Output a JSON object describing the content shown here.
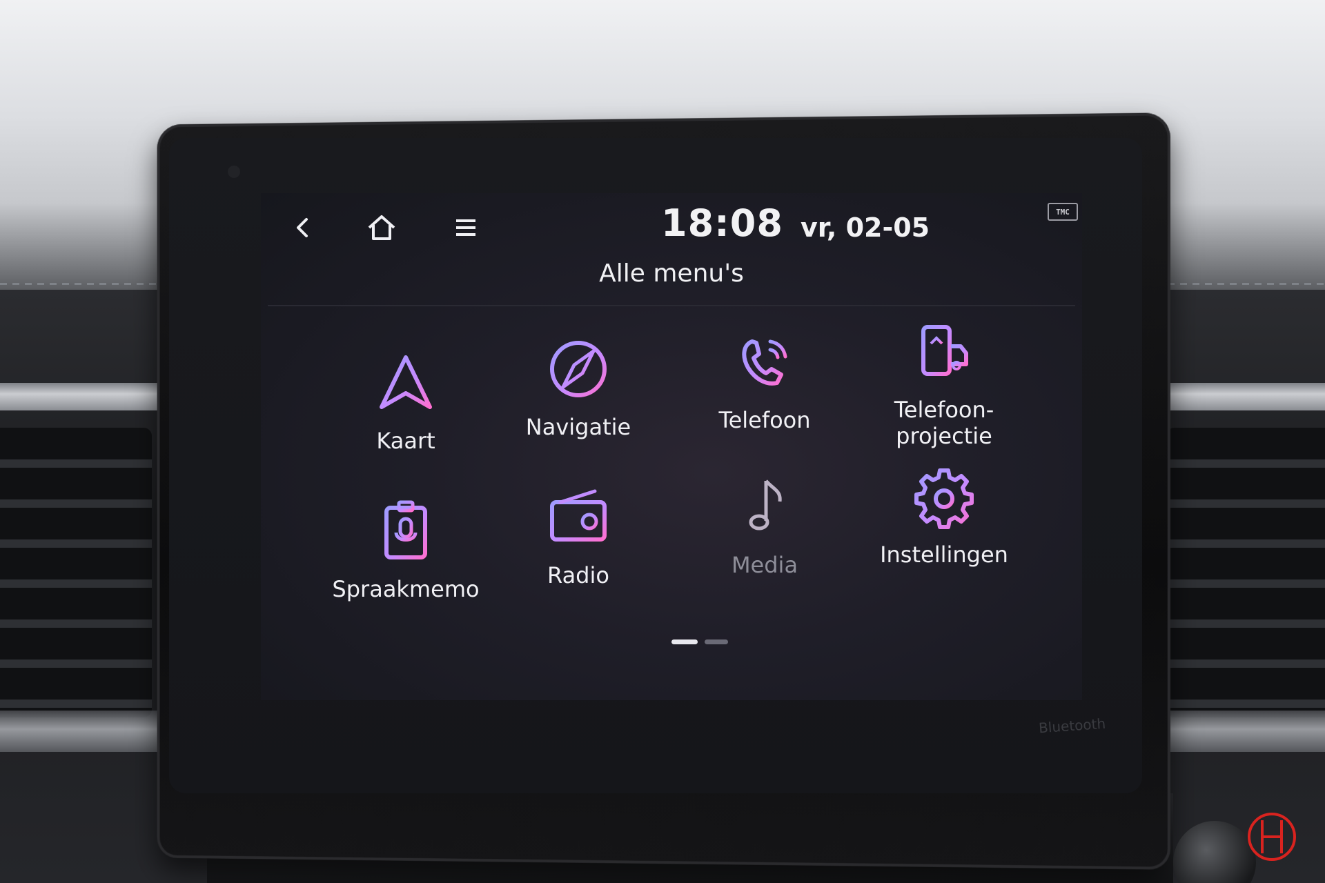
{
  "header": {
    "time": "18:08",
    "date": "vr, 02-05",
    "tmc_badge": "TMC",
    "nav": [
      {
        "icon": "back-chevron-icon"
      },
      {
        "icon": "home-icon"
      },
      {
        "icon": "menu-icon"
      }
    ]
  },
  "page": {
    "title": "Alle menu's",
    "active_page_index": 0,
    "page_count": 2
  },
  "apps": [
    {
      "label": "Kaart",
      "icon": "map-arrow-icon",
      "dimmed": false
    },
    {
      "label": "Navigatie",
      "icon": "compass-icon",
      "dimmed": false
    },
    {
      "label": "Telefoon",
      "icon": "phone-handset-icon",
      "dimmed": false
    },
    {
      "label": "Telefoon-\nprojectie",
      "icon": "phone-projection-icon",
      "dimmed": false
    },
    {
      "label": "Spraakmemo",
      "icon": "voice-memo-icon",
      "dimmed": false
    },
    {
      "label": "Radio",
      "icon": "radio-icon",
      "dimmed": false
    },
    {
      "label": "Media",
      "icon": "music-note-icon",
      "dimmed": true
    },
    {
      "label": "Instellingen",
      "icon": "gear-icon",
      "dimmed": false
    }
  ],
  "bezel": {
    "brand_label": "Bluetooth"
  },
  "colors": {
    "icon_gradient_start": "#b98bff",
    "icon_gradient_end": "#ff6fd0",
    "watermark_red": "#d9231f",
    "dim_text": "#8e8e99"
  }
}
